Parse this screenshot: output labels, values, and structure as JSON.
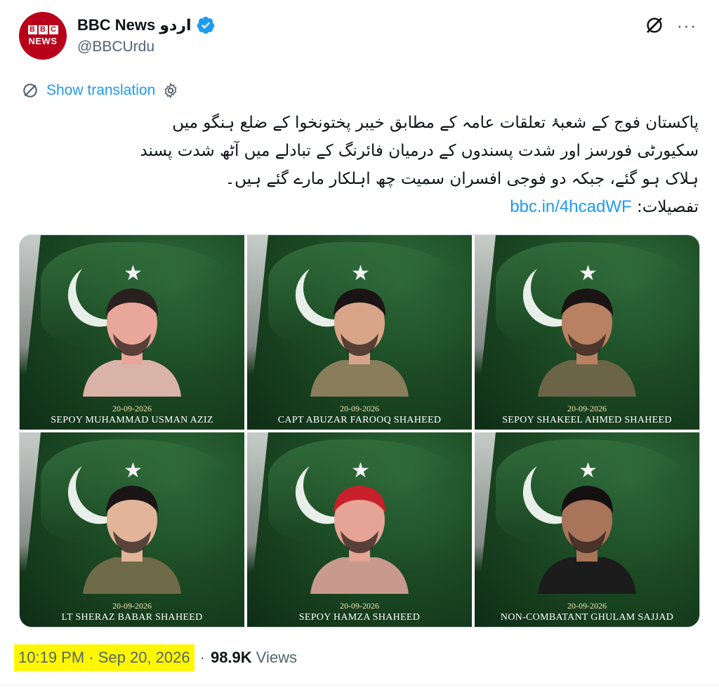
{
  "account": {
    "logo_letters": [
      "B",
      "B",
      "C"
    ],
    "logo_word": "NEWS",
    "display_name": "BBC News اردو",
    "handle": "@BBCUrdu",
    "verified": true,
    "verified_color": "#1d9bf0"
  },
  "actions": {
    "grok_icon": "grok-icon",
    "more_label": "···"
  },
  "translation": {
    "label": "Show translation"
  },
  "tweet": {
    "lines": [
      "پاکستان فوج کے شعبۂ تعلقات عامہ کے مطابق خیبر پختونخوا کے ضلع ہنگو میں",
      "سکیورٹی فورسز اور شدت پسندوں کے درمیان فائرنگ کے تبادلے میں آٹھ شدت پسند",
      "ہلاک ہو گئے، جبکہ دو فوجی افسران سمیت چھ اہلکار مارے گئے ہیں۔"
    ],
    "details_label": "تفصیلات:",
    "link_text": "bbc.in/4hcadWF",
    "link_color": "#1d9bf0"
  },
  "media": {
    "tiles": [
      {
        "date": "20-09-2026",
        "name": "SEPOY MUHAMMAD USMAN AZIZ",
        "skin": "#e8a79a",
        "uniform": "#d9b3a8",
        "hair": "#2a2020"
      },
      {
        "date": "20-09-2026",
        "name": "CAPT ABUZAR FAROOQ SHAHEED",
        "skin": "#d9a58a",
        "uniform": "#8a7d5c",
        "hair": "#1a1514"
      },
      {
        "date": "20-09-2026",
        "name": "SEPOY SHAKEEL AHMED SHAHEED",
        "skin": "#b88162",
        "uniform": "#6c6446",
        "hair": "#1a1514"
      },
      {
        "date": "20-09-2026",
        "name": "LT SHERAZ BABAR SHAHEED",
        "skin": "#e2b49a",
        "uniform": "#6f6a48",
        "hair": "#1a1514"
      },
      {
        "date": "20-09-2026",
        "name": "SEPOY HAMZA SHAHEED",
        "skin": "#e6a496",
        "uniform": "#c89a8e",
        "hair": "#c8202a"
      },
      {
        "date": "20-09-2026",
        "name": "NON-COMBATANT GHULAM SAJJAD",
        "skin": "#a8745a",
        "uniform": "#1c1c1c",
        "hair": "#141010"
      }
    ]
  },
  "meta": {
    "timestamp": "10:19 PM · Sep 20, 2026",
    "separator": "·",
    "views_count": "98.9K",
    "views_label": "Views",
    "highlight_color": "#fff700"
  }
}
